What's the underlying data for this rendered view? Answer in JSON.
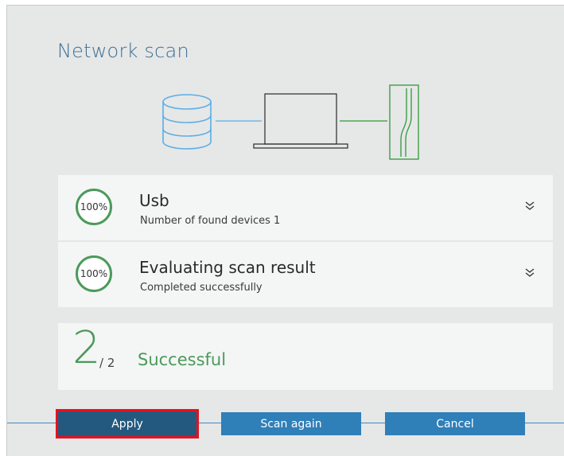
{
  "dialog": {
    "title": "Network scan"
  },
  "diagram": {
    "icons": [
      "database-icon",
      "laptop-icon",
      "device-icon"
    ]
  },
  "scan_steps": [
    {
      "progress": "100%",
      "title": "Usb",
      "subtitle": "Number of found devices 1",
      "expand_icon": "chevron-double-down-icon"
    },
    {
      "progress": "100%",
      "title": "Evaluating scan result",
      "subtitle": "Completed successfully",
      "expand_icon": "chevron-double-down-icon"
    }
  ],
  "summary": {
    "completed": "2",
    "total": "/ 2",
    "status": "Successful"
  },
  "buttons": {
    "apply": "Apply",
    "scan_again": "Scan again",
    "cancel": "Cancel"
  },
  "colors": {
    "accent_blue": "#2f7fb8",
    "apply_blue": "#24597f",
    "success_green": "#4a9a5a",
    "highlight_red": "#e8101e",
    "diagram_blue": "#5aaee6",
    "diagram_green": "#2e9a3a"
  }
}
